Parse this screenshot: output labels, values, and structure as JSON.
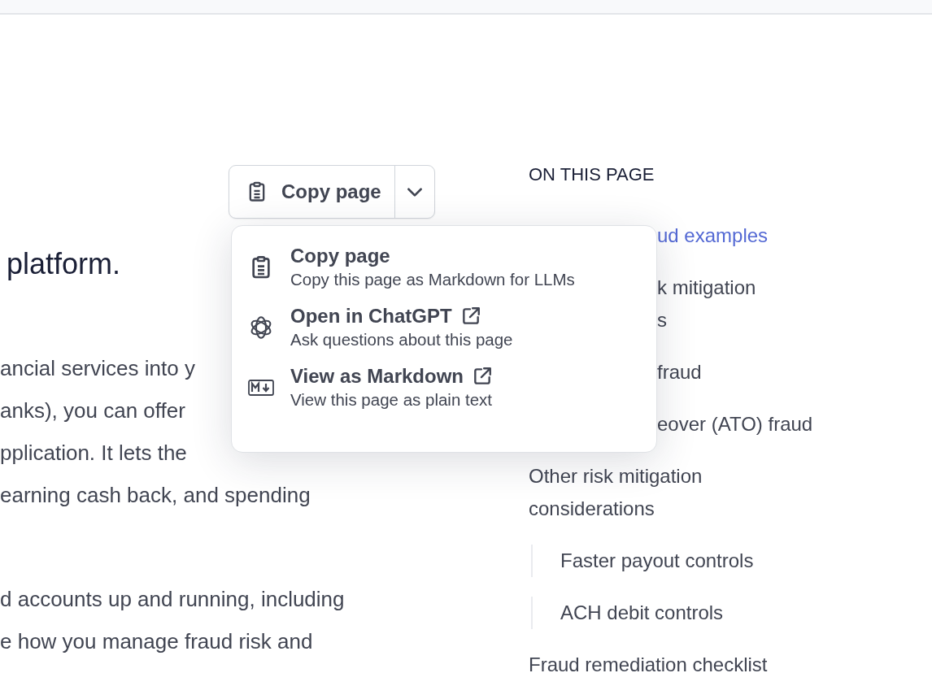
{
  "copy_button": {
    "label": "Copy page"
  },
  "heading": "platform.",
  "paragraphs": [
    [
      "ancial services into y",
      "anks), you can offer",
      "pplication. It lets the",
      "earning cash back, and spending"
    ],
    [
      "d accounts up and running, including",
      "e how you manage fraud risk and"
    ]
  ],
  "menu": [
    {
      "kind": "clipboard",
      "title": "Copy page",
      "description": "Copy this page as Markdown for LLMs",
      "external": false
    },
    {
      "kind": "knot",
      "title": "Open in ChatGPT",
      "description": "Ask questions about this page",
      "external": true
    },
    {
      "kind": "markdown",
      "title": "View as Markdown",
      "description": "View this page as plain text",
      "external": true
    }
  ],
  "toc": {
    "title": "ON THIS PAGE",
    "behind_menu": [
      {
        "lines": [
          "ud examples"
        ],
        "selected": true
      },
      {
        "lines": [
          "k mitigation",
          "s"
        ],
        "selected": false
      },
      {
        "lines": [
          "fraud"
        ],
        "selected": false
      },
      {
        "lines": [
          "eover (ATO) fraud"
        ],
        "selected": false
      }
    ],
    "items": [
      {
        "label": "Other risk mitigation considerations",
        "selected": false,
        "children": [
          {
            "label": "Faster payout controls",
            "selected": false
          },
          {
            "label": "ACH debit controls",
            "selected": false
          }
        ]
      },
      {
        "label": "Fraud remediation checklist",
        "selected": false
      }
    ]
  }
}
